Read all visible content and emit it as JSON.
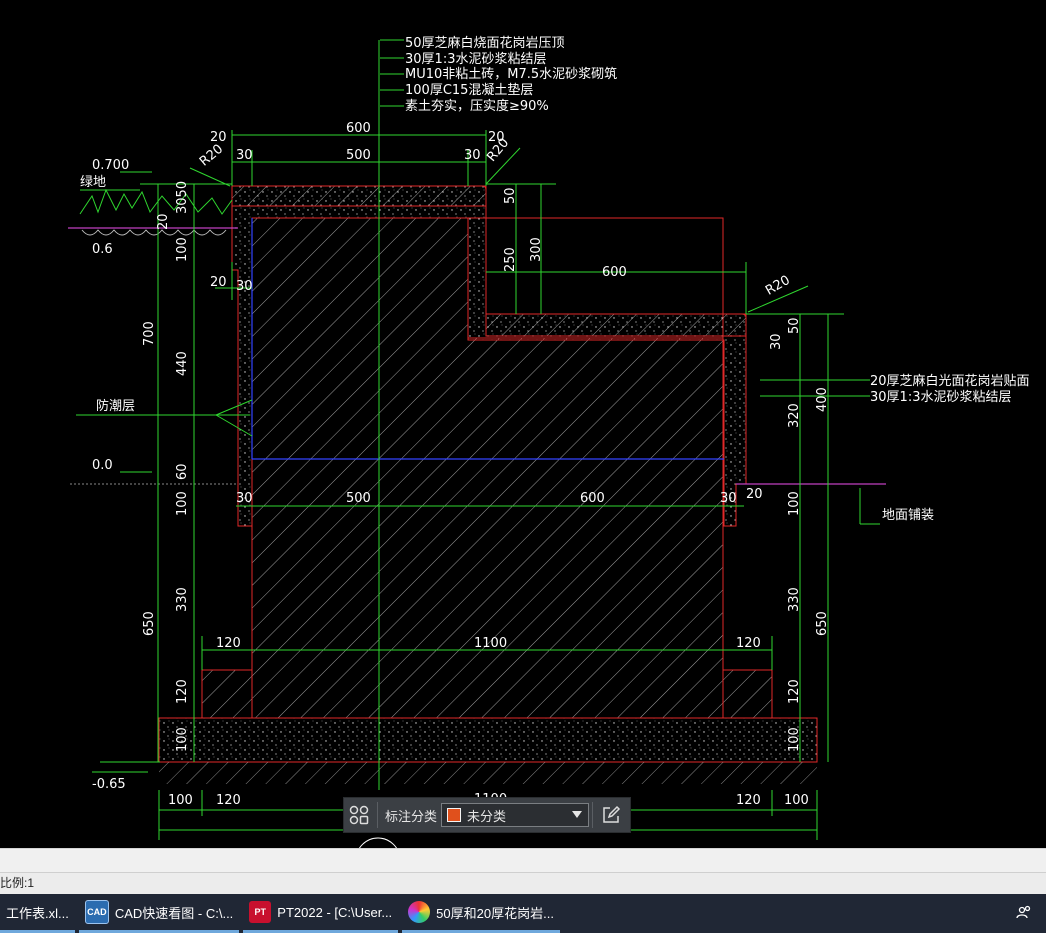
{
  "drawing": {
    "notes_top": [
      "50厚芝麻白烧面花岗岩压顶",
      "30厚1:3水泥砂浆粘结层",
      "MU10非粘土砖，M7.5水泥砂浆砌筑",
      "100厚C15混凝土垫层",
      "素土夯实，压实度≥90%"
    ],
    "notes_right": [
      "20厚芝麻白光面花岗岩贴面",
      "30厚1:3水泥砂浆粘结层"
    ],
    "labels": {
      "green_land": "绿地",
      "damp_proof": "防潮层",
      "ground_paving": "地面铺装"
    },
    "elevations": {
      "top": "0.700",
      "soil": "0.6",
      "zero": "0.0",
      "bottom": "-0.65"
    },
    "radius_left": "R20",
    "radius_top": "R20",
    "radius_right": "R20",
    "dims": {
      "d600_top": "600",
      "d20a": "20",
      "d20b": "20",
      "d30a": "30",
      "d500a": "500",
      "d30b": "30",
      "d50": "50",
      "d300": "300",
      "d250": "250",
      "d600_step": "600",
      "d3050": "3050",
      "d20_left": "20",
      "d100_l1": "100",
      "d20_l2": "20",
      "d30_l2": "30",
      "d700": "700",
      "d440": "440",
      "d60": "60",
      "d100_l3": "100",
      "d330_l": "330",
      "d650_l": "650",
      "d120_l": "120",
      "d100_l4": "100",
      "d50_r": "50",
      "d30_r": "30",
      "d320_r": "320",
      "d400_r": "400",
      "d100_r": "100",
      "d330_r": "330",
      "d650_r": "650",
      "d120_r": "120",
      "d100_r2": "100",
      "d30_m1": "30",
      "d500_m": "500",
      "d600_m": "600",
      "d30_m2": "30",
      "d20_m": "20",
      "d120_f1": "120",
      "d1100_f": "1100",
      "d120_f2": "120",
      "d100_b1": "100",
      "d120_b1": "120",
      "d120_b2": "120",
      "d100_b2": "100",
      "d1100_b": "1100"
    }
  },
  "toolbar": {
    "label": "标注分类",
    "select_value": "未分类",
    "swatch_color": "#e0501c"
  },
  "status": {
    "scale": "比例:1"
  },
  "taskbar": {
    "items": [
      {
        "label": "工作表.xl..."
      },
      {
        "label": "CAD快速看图 - C:\\..."
      },
      {
        "label": "PT2022 - [C:\\User..."
      },
      {
        "label": "50厚和20厚花岗岩..."
      }
    ]
  }
}
